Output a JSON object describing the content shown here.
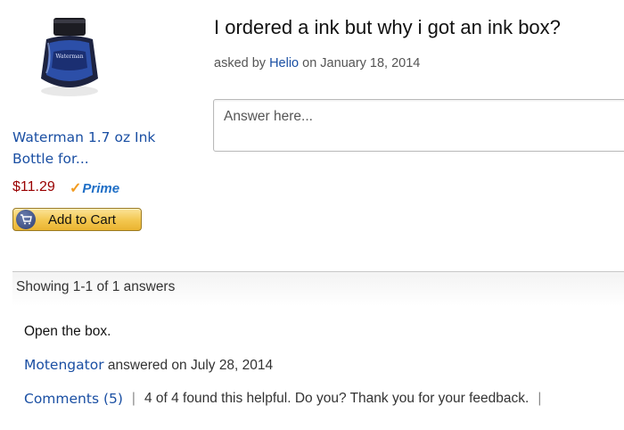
{
  "product": {
    "title": "Waterman 1.7 oz Ink Bottle for...",
    "price": "$11.29",
    "prime_label": "Prime",
    "cart_button": "Add to Cart"
  },
  "question": {
    "title": "I ordered a ink but why i got an ink box?",
    "asked_prefix": "asked by ",
    "asker": "Helio",
    "asked_date": " on January 18, 2014"
  },
  "answer_input": {
    "placeholder": "Answer here..."
  },
  "answers_summary": "Showing 1-1 of 1 answers",
  "answers": [
    {
      "text": "Open the box.",
      "author": "Motengator",
      "answered_suffix": " answered on July 28, 2014",
      "comments_label": "Comments (5)",
      "helpful_text": "4 of 4 found this helpful. Do you? Thank you for your feedback."
    }
  ],
  "colors": {
    "link": "#1a4fa3",
    "price": "#990000",
    "prime_check": "#f29b20",
    "cart_button": "#f3c74f"
  }
}
